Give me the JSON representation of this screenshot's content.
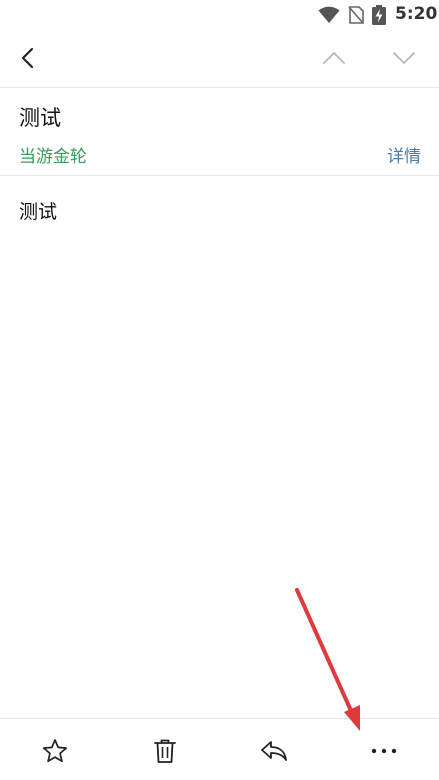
{
  "status_bar": {
    "time": "5:20",
    "icons": [
      "wifi-icon",
      "no-sim-icon",
      "battery-charging-icon"
    ]
  },
  "app_bar": {
    "icons": {
      "back": "chevron-left-icon",
      "prev": "chevron-up-icon",
      "next": "chevron-down-icon"
    }
  },
  "message": {
    "subject": "测试",
    "sender": "当游金轮",
    "details_link": "详情",
    "body": "测试"
  },
  "bottom_toolbar": {
    "icons": [
      "star-icon",
      "trash-icon",
      "reply-icon",
      "more-horizontal-icon"
    ]
  },
  "colors": {
    "sender": "#3a9a58",
    "details_link": "#4a7ea6",
    "annotation_arrow": "#e0393e",
    "divider": "#e6e6e6"
  }
}
